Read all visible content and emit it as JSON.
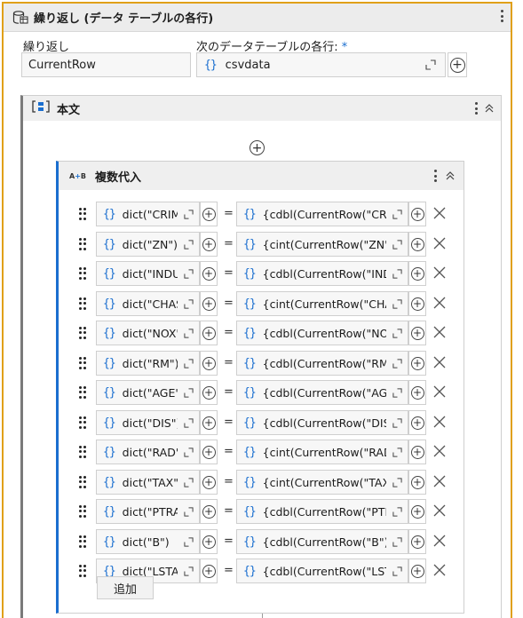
{
  "activity": {
    "title": "繰り返し (データ テーブルの各行)",
    "repeat_label": "繰り返し",
    "repeat_value": "CurrentRow",
    "each_row_label": "次のデータテーブルの各行:",
    "required_mark": "*",
    "datatable_value": "csvdata"
  },
  "body": {
    "title": "本文"
  },
  "assign": {
    "title": "複数代入",
    "add_label": "追加",
    "rows": [
      {
        "left": "dict(\"CRIM",
        "right": "{cdbl(CurrentRow(\"CRIM"
      },
      {
        "left": "dict(\"ZN\")",
        "right": "{cint(CurrentRow(\"ZN\"))"
      },
      {
        "left": "dict(\"INDU",
        "right": "{cdbl(CurrentRow(\"INDU"
      },
      {
        "left": "dict(\"CHAS",
        "right": "{cint(CurrentRow(\"CHAS"
      },
      {
        "left": "dict(\"NOX\"",
        "right": "{cdbl(CurrentRow(\"NOX"
      },
      {
        "left": "dict(\"RM\")",
        "right": "{cdbl(CurrentRow(\"RM\""
      },
      {
        "left": "dict(\"AGE\"",
        "right": "{cdbl(CurrentRow(\"AGE\""
      },
      {
        "left": "dict(\"DIS\")",
        "right": "{cdbl(CurrentRow(\"DIS\""
      },
      {
        "left": "dict(\"RAD\"",
        "right": "{cint(CurrentRow(\"RAD\""
      },
      {
        "left": "dict(\"TAX\"",
        "right": "{cint(CurrentRow(\"TAX\""
      },
      {
        "left": "dict(\"PTRA",
        "right": "{cdbl(CurrentRow(\"PTRA"
      },
      {
        "left": "dict(\"B\")",
        "right": "{cdbl(CurrentRow(\"B\"))}"
      },
      {
        "left": "dict(\"LSTA",
        "right": "{cdbl(CurrentRow(\"LSTA"
      }
    ],
    "equals": "=",
    "expr_braces": "{}"
  },
  "colors": {
    "accent": "#1a6ecf",
    "selection_border": "#e0a019"
  },
  "icons": {
    "activity": "database-icon",
    "body": "sequence-icon",
    "assign": "assign-icon",
    "row_handle": "drag-handle-icon",
    "row_delete": "close-icon",
    "add": "plus-circle-icon"
  }
}
